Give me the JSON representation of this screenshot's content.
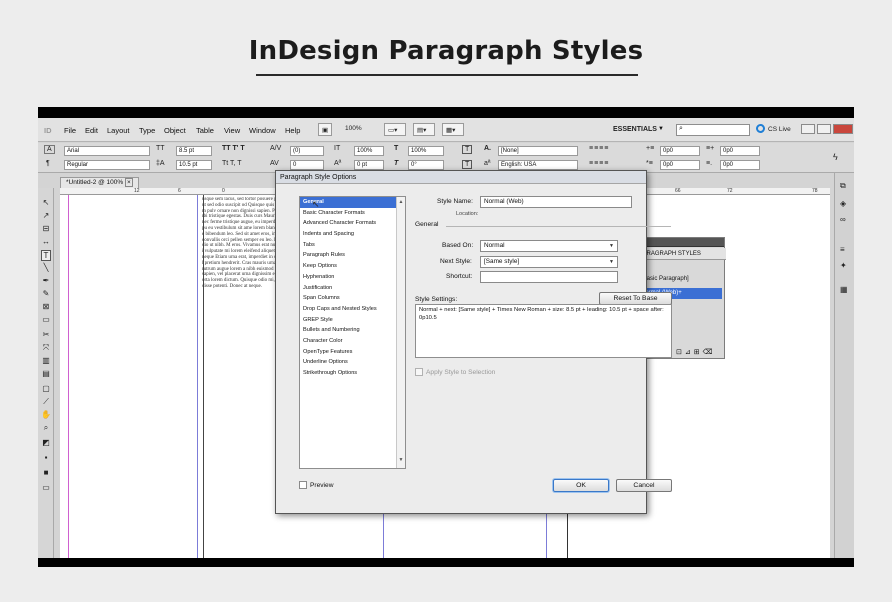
{
  "page": {
    "heading": "InDesign Paragraph Styles"
  },
  "menubar": {
    "app_logo": "ID",
    "items": [
      "File",
      "Edit",
      "Layout",
      "Type",
      "Object",
      "Table",
      "View",
      "Window",
      "Help"
    ],
    "zoom": "100%",
    "workspace": "ESSENTIALS",
    "cs_live": "CS Live"
  },
  "control": {
    "font_family": "Arial",
    "font_style": "Regular",
    "size": "8.5 pt",
    "leading": "10.5 pt",
    "kerning": "(0)",
    "tracking": "0",
    "vscale": "100%",
    "hscale": "100%",
    "baseline": "0 pt",
    "skew": "0°",
    "char_style": "[None]",
    "language": "English: USA",
    "indent_left": "0p0",
    "indent_first": "0p0",
    "indent_right": "0p0",
    "indent_last": "0p0",
    "space_before": "0p0",
    "space_after": "0p0"
  },
  "document": {
    "tab_title": "*Untitled-2 @ 100%",
    "ruler": [
      "12",
      "6",
      "0",
      "66",
      "72",
      "78"
    ],
    "body_text": "usque sem lacus, sed tortor posuere pretium dui, sed metus non volutpat congue molestie ut sed odio suscipit od Quisque quis libero sollicitudin tempus egestas vehic Proin interdum pulv ornare non dignissi sapien. Proin mi od Pellentesque tinc Proin quis mi dictum morbi tristique egestas. Duis curs Mauris auctor, nisl neque, eget condim posuere lorem. Donec ferme tristique augue, eu imperdiet nil molest aliquet. Sed non dig condimentum tempu eu vestibulum sit ame lorem blandit. Pro lorem consequat. Do accumsan, magna s vitae bibendum leo. Sed sit amet eros, imperdiet vitae condimentum tempus per euismod nisl convallis orci pellen semper eu leo. In lacus, Vivamus eu neque eget ligula lacinia, felis odio ut nibh. M eros. Vivamus erat nu Nulla commodo auc Duis placerat has viverra erat di vulputate mi lorem eleifend aliquet. Proin placerat. Donec eget placerat so Proin neque neque Etiam urna erat, imperdiet in ornare sit amet sapien. Aenean commodo urna nec nisl pretium hendrerit. Cras mauris urna, sagittis mollis ultrices at, varius ac ligula. Aliquam rutrum augue lorem a nibh euismod nec tincidunt arcu sodales. Proin fermentum placerat sapien, vel placerat urna dignissim eget. Nunc ornare metus tincidunt sem imperdiet vel porta lorem dictum. Quisque odio mi, sollicitudin ac ornare ac, ac aliquet ac lectus. Suspendisse potenti. Donec at neque."
  },
  "paragraph_styles_panel": {
    "title": "PARAGRAPH STYLES",
    "items": [
      "[Basic Paragraph]",
      "Normal (Web)+"
    ]
  },
  "dialog": {
    "title": "Paragraph Style Options",
    "categories": [
      "General",
      "Basic Character Formats",
      "Advanced Character Formats",
      "Indents and Spacing",
      "Tabs",
      "Paragraph Rules",
      "Keep Options",
      "Hyphenation",
      "Justification",
      "Span Columns",
      "Drop Caps and Nested Styles",
      "GREP Style",
      "Bullets and Numbering",
      "Character Color",
      "OpenType Features",
      "Underline Options",
      "Strikethrough Options"
    ],
    "selected_category": "General",
    "style_name_label": "Style Name:",
    "style_name": "Normal (Web)",
    "location_label": "Location:",
    "section_general": "General",
    "based_on_label": "Based On:",
    "based_on": "Normal",
    "next_style_label": "Next Style:",
    "next_style": "[Same style]",
    "shortcut_label": "Shortcut:",
    "shortcut": "",
    "style_settings_label": "Style Settings:",
    "reset_button": "Reset To Base",
    "style_settings": "Normal + next: [Same style] + Times New Roman + size: 8.5 pt + leading: 10.5 pt + space after: 0p10.5",
    "apply_label": "Apply Style to Selection",
    "preview_label": "Preview",
    "ok": "OK",
    "cancel": "Cancel"
  }
}
